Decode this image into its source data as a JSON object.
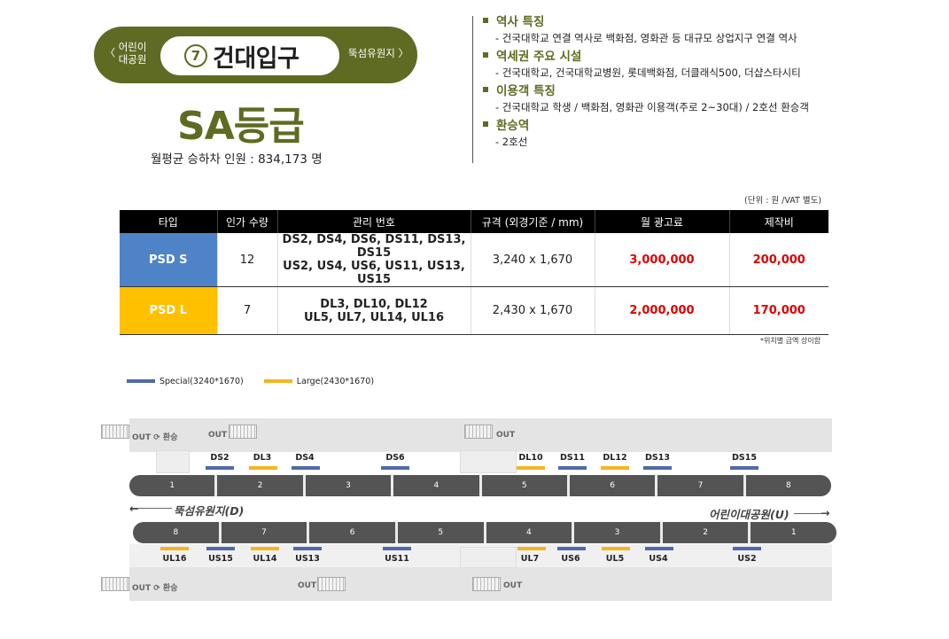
{
  "station": {
    "number": "7",
    "name": "건대입구",
    "prev": "어린이\n대공원",
    "prev_arrow": "〈",
    "next": "뚝섬유원지",
    "next_arrow": "〉",
    "grade": "SA등급",
    "monthly_label": "월평균 승하차 인원 : 834,173 명"
  },
  "info": [
    {
      "head": "역사 특징",
      "desc": "-   건국대학교 연결 역사로 백화점, 영화관 등 대규모 상업지구 연결 역사"
    },
    {
      "head": "역세권 주요 시설",
      "desc": "-   건국대학교, 건국대학교병원, 롯데백화점, 더클래식500, 더샵스타시티"
    },
    {
      "head": "이용객 특징",
      "desc": "-   건국대학교 학생 / 백화점, 영화관 이용객(주로 2~30대) / 2호선 환승객"
    },
    {
      "head": "환승역",
      "desc": "-   2호선"
    }
  ],
  "unit_note": "(단위 : 원 /VAT 별도)",
  "foot_note": "*위치별 금액 상이함",
  "table": {
    "headers": [
      "타입",
      "인가 수량",
      "관리 번호",
      "규격 (외경기준 / mm)",
      "월 광고료",
      "제작비"
    ],
    "rows": [
      {
        "type": "PSD S",
        "qty": "12",
        "codes1": "DS2, DS4, DS6, DS11, DS13, DS15",
        "codes2": "US2, US4, US6, US11, US13, US15",
        "size": "3,240 x 1,670",
        "fee": "3,000,000",
        "prod": "200,000"
      },
      {
        "type": "PSD L",
        "qty": "7",
        "codes1": "DL3, DL10, DL12",
        "codes2": "UL5, UL7, UL14, UL16",
        "size": "2,430 x 1,670",
        "fee": "2,000,000",
        "prod": "170,000"
      }
    ]
  },
  "legend": {
    "special": "Special(3240*1670)",
    "large": "Large(2430*1670)",
    "special_color": "#4e6aa8",
    "large_color": "#f5b520"
  },
  "platform": {
    "top_cars": [
      "1",
      "2",
      "3",
      "4",
      "5",
      "6",
      "7",
      "8"
    ],
    "bottom_cars": [
      "8",
      "7",
      "6",
      "5",
      "4",
      "3",
      "2",
      "1"
    ],
    "dir_left": "뚝섬유원지(D)",
    "dir_right": "어린이대공원(U)",
    "exit_out": "OUT",
    "exit_transfer": "환승",
    "top_doors": [
      "DS2",
      "DL3",
      "DS4",
      "DS6",
      "DL10",
      "DS11",
      "DL12",
      "DS13",
      "DS15"
    ],
    "bottom_doors": [
      "UL16",
      "US15",
      "UL14",
      "US13",
      "US11",
      "UL7",
      "US6",
      "UL5",
      "US4",
      "US2"
    ]
  }
}
